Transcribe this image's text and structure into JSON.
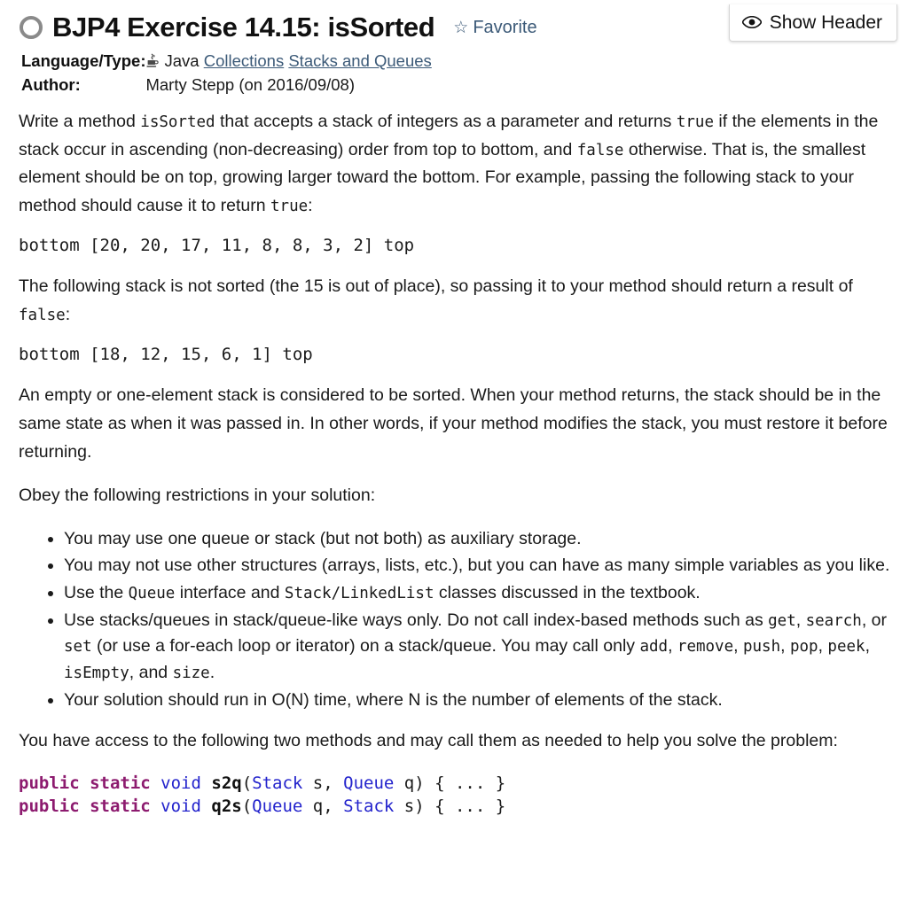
{
  "floating": {
    "show_header_label": "Show Header",
    "eye_icon": "eye-icon"
  },
  "header": {
    "status_icon": "unsolved-circle-icon",
    "title": "BJP4 Exercise 14.15: isSorted",
    "favorite_label": "Favorite",
    "favorite_star": "☆",
    "link_color": "#3c5a78"
  },
  "meta": {
    "language_label": "Language/Type:",
    "language_icon": "java-coffee-cup-icon",
    "language_value": "Java",
    "tags": [
      "Collections",
      "Stacks and Queues"
    ],
    "author_label": "Author:",
    "author_value": "Marty Stepp (on 2016/09/08)"
  },
  "body": {
    "p1": {
      "a": "Write a method ",
      "code1": "isSorted",
      "b": " that accepts a stack of integers as a parameter and returns ",
      "code2": "true",
      "c": " if the elements in the stack occur in ascending (non-decreasing) order from top to bottom, and ",
      "code3": "false",
      "d": " otherwise. That is, the smallest element should be on top, growing larger toward the bottom. For example, passing the following stack to your method should cause it to return ",
      "code4": "true",
      "e": ":"
    },
    "stack_example_1": "bottom [20, 20, 17, 11, 8, 8, 3, 2] top",
    "p2": {
      "a": "The following stack is not sorted (the 15 is out of place), so passing it to your method should return a result of ",
      "code1": "false",
      "b": ":"
    },
    "stack_example_2": "bottom [18, 12, 15, 6, 1] top",
    "p3": "An empty or one-element stack is considered to be sorted. When your method returns, the stack should be in the same state as when it was passed in. In other words, if your method modifies the stack, you must restore it before returning.",
    "p4": "Obey the following restrictions in your solution:",
    "rules": [
      {
        "parts": [
          {
            "t": "text",
            "v": "You may use one queue or stack (but not both) as auxiliary storage."
          }
        ]
      },
      {
        "parts": [
          {
            "t": "text",
            "v": "You may not use other structures (arrays, lists, etc.), but you can have as many simple variables as you like."
          }
        ]
      },
      {
        "parts": [
          {
            "t": "text",
            "v": "Use the "
          },
          {
            "t": "code",
            "v": "Queue"
          },
          {
            "t": "text",
            "v": " interface and "
          },
          {
            "t": "code",
            "v": "Stack/LinkedList"
          },
          {
            "t": "text",
            "v": " classes discussed in the textbook."
          }
        ]
      },
      {
        "parts": [
          {
            "t": "text",
            "v": "Use stacks/queues in stack/queue-like ways only. Do not call index-based methods such as "
          },
          {
            "t": "code",
            "v": "get"
          },
          {
            "t": "text",
            "v": ", "
          },
          {
            "t": "code",
            "v": "search"
          },
          {
            "t": "text",
            "v": ", or "
          },
          {
            "t": "code",
            "v": "set"
          },
          {
            "t": "text",
            "v": " (or use a for-each loop or iterator) on a stack/queue. You may call only "
          },
          {
            "t": "code",
            "v": "add"
          },
          {
            "t": "text",
            "v": ", "
          },
          {
            "t": "code",
            "v": "remove"
          },
          {
            "t": "text",
            "v": ", "
          },
          {
            "t": "code",
            "v": "push"
          },
          {
            "t": "text",
            "v": ", "
          },
          {
            "t": "code",
            "v": "pop"
          },
          {
            "t": "text",
            "v": ", "
          },
          {
            "t": "code",
            "v": "peek"
          },
          {
            "t": "text",
            "v": ", "
          },
          {
            "t": "code",
            "v": "isEmpty"
          },
          {
            "t": "text",
            "v": ", and "
          },
          {
            "t": "code",
            "v": "size"
          },
          {
            "t": "text",
            "v": "."
          }
        ]
      },
      {
        "parts": [
          {
            "t": "text",
            "v": "Your solution should run in O(N) time, where N is the number of elements of the stack."
          }
        ]
      }
    ],
    "p5": "You have access to the following two methods and may call them as needed to help you solve the problem:",
    "code_block": {
      "lines": [
        [
          {
            "cls": "kw",
            "v": "public static "
          },
          {
            "cls": "ret",
            "v": "void"
          },
          {
            "cls": "plain",
            "v": " "
          },
          {
            "cls": "fn",
            "v": "s2q"
          },
          {
            "cls": "plain",
            "v": "("
          },
          {
            "cls": "type",
            "v": "Stack"
          },
          {
            "cls": "plain",
            "v": " s, "
          },
          {
            "cls": "type",
            "v": "Queue"
          },
          {
            "cls": "plain",
            "v": " q) { ... }"
          }
        ],
        [
          {
            "cls": "kw",
            "v": "public static "
          },
          {
            "cls": "ret",
            "v": "void"
          },
          {
            "cls": "plain",
            "v": " "
          },
          {
            "cls": "fn",
            "v": "q2s"
          },
          {
            "cls": "plain",
            "v": "("
          },
          {
            "cls": "type",
            "v": "Queue"
          },
          {
            "cls": "plain",
            "v": " q, "
          },
          {
            "cls": "type",
            "v": "Stack"
          },
          {
            "cls": "plain",
            "v": " s) { ... }"
          }
        ]
      ],
      "colors": {
        "keyword": "#8d1b6f",
        "type": "#2222cc",
        "function": "#111111",
        "plain": "#1a1a1a"
      }
    }
  }
}
